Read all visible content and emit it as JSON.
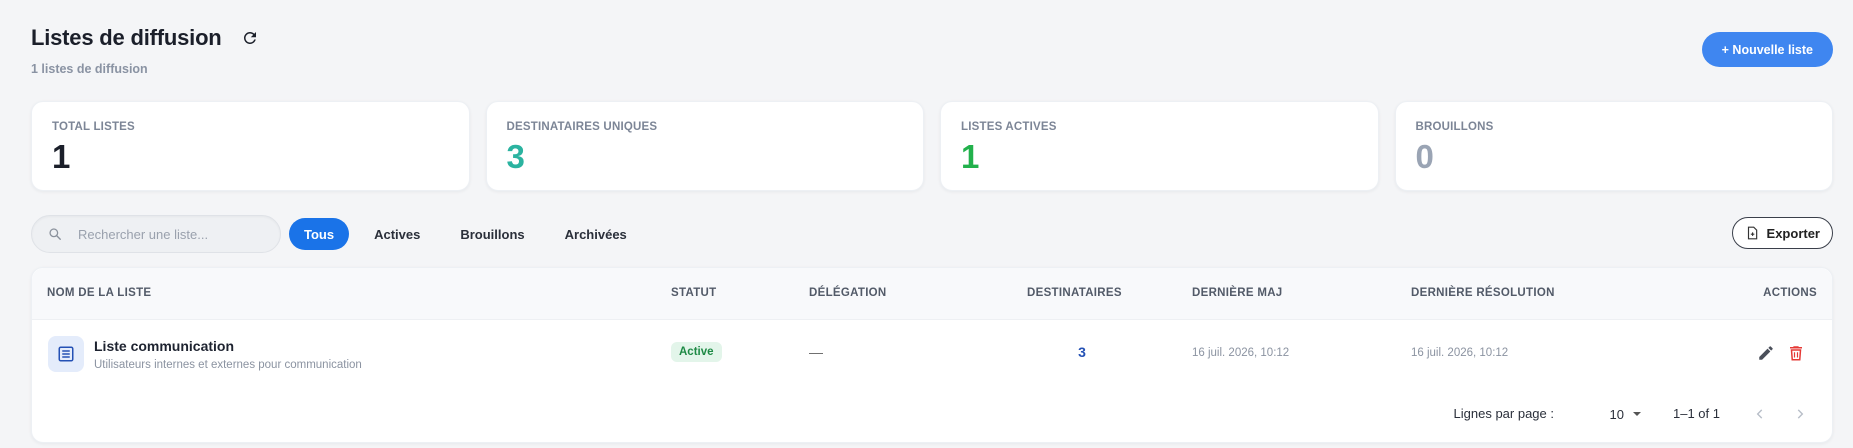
{
  "header": {
    "title": "Listes de diffusion",
    "subtitle": "1 listes de diffusion",
    "new_list_label": "+ Nouvelle liste",
    "refresh_icon": "refresh-icon"
  },
  "stats": [
    {
      "label": "TOTAL LISTES",
      "value": "1",
      "color": "#1b1f2a"
    },
    {
      "label": "DESTINATAIRES UNIQUES",
      "value": "3",
      "color": "#2bb3a0"
    },
    {
      "label": "LISTES ACTIVES",
      "value": "1",
      "color": "#22b14c"
    },
    {
      "label": "BROUILLONS",
      "value": "0",
      "color": "#9aa4b4"
    }
  ],
  "toolbar": {
    "search_placeholder": "Rechercher une liste...",
    "filters": [
      "Tous",
      "Actives",
      "Brouillons",
      "Archivées"
    ],
    "active_filter": "Tous",
    "export_label": "Exporter"
  },
  "table": {
    "columns": [
      "NOM DE LA LISTE",
      "STATUT",
      "DÉLÉGATION",
      "DESTINATAIRES",
      "DERNIÈRE MAJ",
      "DERNIÈRE RÉSOLUTION",
      "ACTIONS"
    ],
    "rows": [
      {
        "name": "Liste communication",
        "description": "Utilisateurs internes et externes pour communication",
        "status": "Active",
        "delegation": "—",
        "recipients": "3",
        "last_update": "16 juil. 2026, 10:12",
        "last_resolution": "16 juil. 2026, 10:12"
      }
    ]
  },
  "pagination": {
    "rows_per_page_label": "Lignes par page :",
    "rows_per_page": "10",
    "range": "1–1 of 1"
  },
  "colors": {
    "accent": "#3f86f0",
    "active_tab": "#1a73e8",
    "status_active_bg": "#e3f5ea",
    "status_active_fg": "#1e8a45",
    "delete": "#e53935",
    "link": "#2451b5"
  }
}
